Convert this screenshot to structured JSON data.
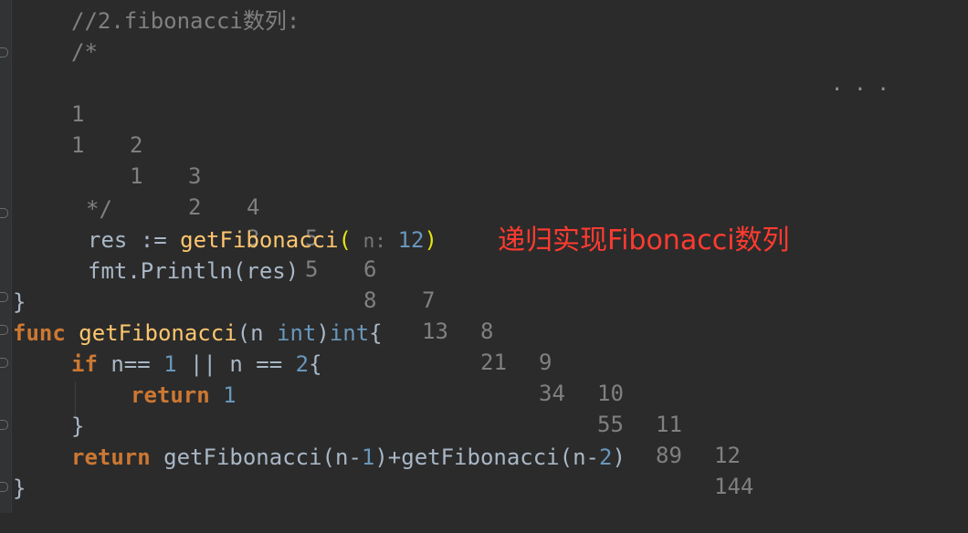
{
  "editor": {
    "comment_title": "//2.fibonacci数列:",
    "comment_open": "/*",
    "index_row": [
      "1",
      "2",
      "3",
      "4",
      "5",
      "6",
      "7",
      "8",
      "9",
      "10",
      "11",
      "12"
    ],
    "value_row": [
      "1",
      "1",
      "2",
      "3",
      "5",
      "8",
      "13",
      "21",
      "34",
      "55",
      "89",
      "144"
    ],
    "ellipsis": "...",
    "comment_close": "*/",
    "line_res": {
      "prefix": "res := ",
      "func": "getFibonacci",
      "paren_open": "(",
      "hint": " n: ",
      "arg": "12",
      "paren_close": ")"
    },
    "line_print": "fmt.Println(res)",
    "close_brace": "}",
    "func_decl": {
      "kw": "func",
      "name": "getFibonacci",
      "rest1": "(n ",
      "type1": "int",
      "rest2": ")",
      "type2": "int",
      "rest3": "{"
    },
    "if_line": {
      "kw": "if",
      "a": " n== ",
      "n1": "1",
      "b": " || n == ",
      "n2": "2",
      "c": "{"
    },
    "return1": {
      "kw": "return",
      "num": "1"
    },
    "inner_close": "}",
    "return2": {
      "kw": "return",
      "a": " getFibonacci(n-",
      "n1": "1",
      "b": ")+getFibonacci(n-",
      "n2": "2",
      "c": ")"
    },
    "final_close": "}"
  },
  "annotation": "递归实现Fibonacci数列",
  "colors": {
    "background": "#2b2b2b",
    "comment": "#808080",
    "keyword": "#cc7832",
    "function": "#ffc66d",
    "number": "#6897bb",
    "text": "#a9b7c6",
    "annotation": "#ff3b30"
  }
}
